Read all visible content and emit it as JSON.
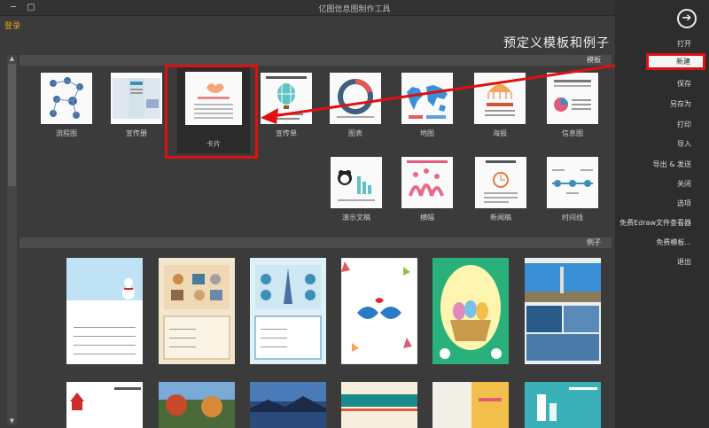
{
  "window": {
    "title": "亿图信息图制作工具",
    "min_icon": "minimize-icon",
    "max_icon": "maximize-icon"
  },
  "login": "登录",
  "heading": "预定义模板和例子",
  "templates_section": "模板",
  "examples_section": "例子",
  "templates_row1": [
    {
      "label": "流程图"
    },
    {
      "label": "宣传册"
    },
    {
      "label": "卡片"
    },
    {
      "label": "宣传单"
    },
    {
      "label": "图表"
    },
    {
      "label": "地图"
    },
    {
      "label": "海报"
    },
    {
      "label": "信息图"
    }
  ],
  "templates_row2": [
    {
      "label": "演示文稿"
    },
    {
      "label": "横幅"
    },
    {
      "label": "新闻稿"
    },
    {
      "label": "时间线"
    }
  ],
  "sidebar": {
    "back_icon": "back-arrow-icon",
    "items": [
      "打开",
      "新建",
      "保存",
      "另存为",
      "打印",
      "导入",
      "导出 & 发送",
      "关闭",
      "选项",
      "免费Edraw文件查看器",
      "免费模板...",
      "退出"
    ]
  },
  "colors": {
    "highlight": "#e01010",
    "accent": "#e8a317"
  }
}
